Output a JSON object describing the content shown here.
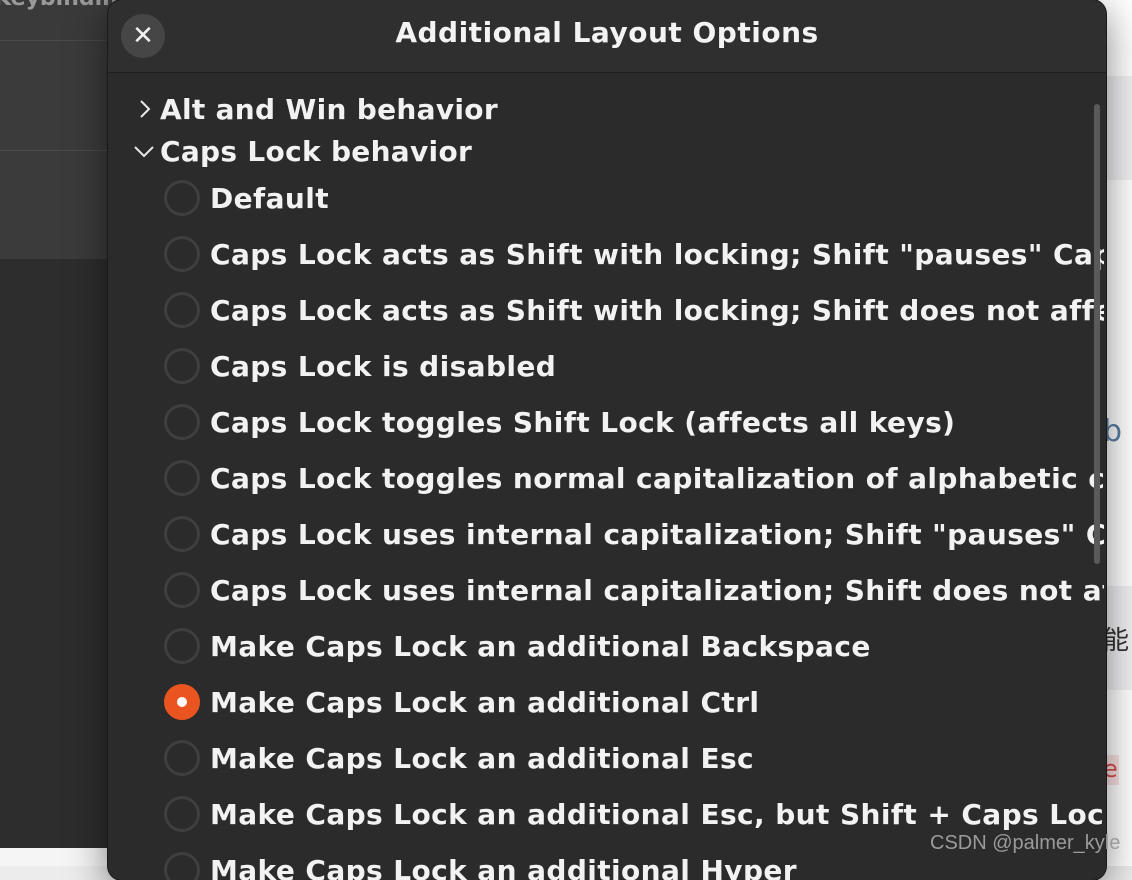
{
  "background": {
    "header_text": "Keybindings",
    "right_fragment_1": "b",
    "right_fragment_2": "能",
    "right_fragment_3": "e"
  },
  "dialog": {
    "title": "Additional Layout Options",
    "close_icon": "close-icon",
    "sections": [
      {
        "label": "Alt and Win behavior",
        "expanded": false
      },
      {
        "label": "Caps Lock behavior",
        "expanded": true
      }
    ],
    "options": [
      {
        "label": "Default",
        "checked": false
      },
      {
        "label": "Caps Lock acts as Shift with locking; Shift \"pauses\" Caps Lock",
        "checked": false
      },
      {
        "label": "Caps Lock acts as Shift with locking; Shift does not affect Caps Lock",
        "checked": false
      },
      {
        "label": "Caps Lock is disabled",
        "checked": false
      },
      {
        "label": "Caps Lock toggles Shift Lock (affects all keys)",
        "checked": false
      },
      {
        "label": "Caps Lock toggles normal capitalization of alphabetic characters",
        "checked": false
      },
      {
        "label": "Caps Lock uses internal capitalization; Shift \"pauses\" Caps Lock",
        "checked": false
      },
      {
        "label": "Caps Lock uses internal capitalization; Shift does not affect Caps Lock",
        "checked": false
      },
      {
        "label": "Make Caps Lock an additional Backspace",
        "checked": false
      },
      {
        "label": "Make Caps Lock an additional Ctrl",
        "checked": true
      },
      {
        "label": "Make Caps Lock an additional Esc",
        "checked": false
      },
      {
        "label": "Make Caps Lock an additional Esc, but Shift + Caps Lock is the regular Caps Lock",
        "checked": false
      },
      {
        "label": "Make Caps Lock an additional Hyper",
        "checked": false
      }
    ]
  },
  "watermark": "CSDN @palmer_kyle",
  "colors": {
    "accent": "#e95420",
    "dialog_bg": "#2b2b2b",
    "text": "#f2f2f2"
  }
}
